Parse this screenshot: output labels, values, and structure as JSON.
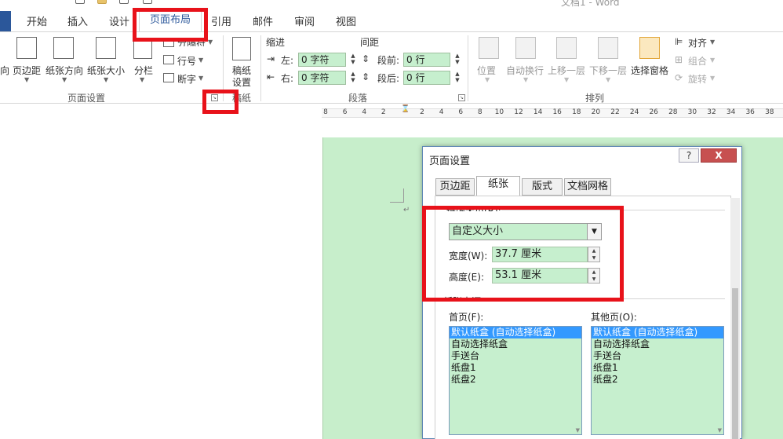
{
  "app_title": "文档1 - Word",
  "tabs": [
    "开始",
    "插入",
    "设计",
    "页面布局",
    "引用",
    "邮件",
    "审阅",
    "视图"
  ],
  "ribbon": {
    "page_setup": {
      "direction_partial": "向",
      "margins": "页边距",
      "orientation": "纸张方向",
      "size": "纸张大小",
      "columns": "分栏",
      "breaks": "分隔符",
      "line_numbers": "行号",
      "hyphenation": "断字",
      "group_label": "页面设置"
    },
    "manuscript": {
      "label_line1": "稿纸",
      "label_line2": "设置",
      "group_label": "稿纸"
    },
    "paragraph": {
      "indent_heading": "缩进",
      "spacing_heading": "间距",
      "left_label": "左:",
      "left_value": "0 字符",
      "right_label": "右:",
      "right_value": "0 字符",
      "before_label": "段前:",
      "before_value": "0 行",
      "after_label": "段后:",
      "after_value": "0 行",
      "group_label": "段落"
    },
    "arrange": {
      "position": "位置",
      "wrap_text": "自动换行",
      "bring_forward": "上移一层",
      "send_backward": "下移一层",
      "selection_pane": "选择窗格",
      "align": "对齐",
      "group": "组合",
      "rotate": "旋转",
      "group_label": "排列"
    }
  },
  "ruler_ticks": [
    "8",
    "6",
    "4",
    "2",
    "",
    "2",
    "4",
    "6",
    "8",
    "10",
    "12",
    "14",
    "16",
    "18",
    "20",
    "22",
    "24",
    "26",
    "28",
    "30",
    "32",
    "34",
    "36",
    "38"
  ],
  "dialog": {
    "title": "页面设置",
    "help": "?",
    "close": "X",
    "tabs": [
      "页边距",
      "纸张",
      "版式",
      "文档网格"
    ],
    "active_tab": "纸张",
    "paper_size_label": "纸张大小(R):",
    "paper_size_value": "自定义大小",
    "width_label": "宽度(W):",
    "width_value": "37.7 厘米",
    "height_label": "高度(E):",
    "height_value": "53.1 厘米",
    "paper_source_label": "纸张来源",
    "first_page_label": "首页(F):",
    "other_pages_label": "其他页(O):",
    "first_page_options": [
      "默认纸盒 (自动选择纸盒)",
      "自动选择纸盒",
      "手送台",
      "纸盘1",
      "纸盘2"
    ],
    "other_pages_options": [
      "默认纸盒 (自动选择纸盒)",
      "自动选择纸盒",
      "手送台",
      "纸盘1",
      "纸盘2"
    ]
  },
  "colors": {
    "highlight": "#e8121a",
    "field_green": "#c6efce",
    "page_green": "#c7eecb",
    "accent": "#2b579a",
    "selection": "#3399ff"
  }
}
